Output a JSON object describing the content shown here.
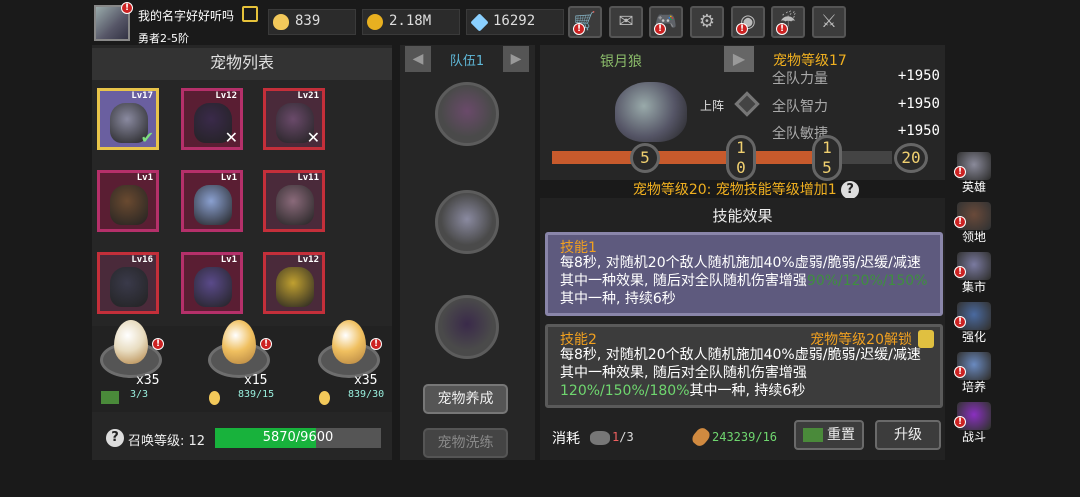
{
  "player": {
    "name": "我的名字好好听吗",
    "rank": "勇者2-5阶"
  },
  "resources": {
    "eggs": "839",
    "gold": "2.18M",
    "gems": "16292"
  },
  "top_buttons": [
    {
      "name": "shop-cart-icon",
      "glyph": "🛒",
      "alert": "!"
    },
    {
      "name": "mail-icon",
      "glyph": "✉",
      "alert": ""
    },
    {
      "name": "gamepad-icon",
      "glyph": "🎮",
      "alert": "!"
    },
    {
      "name": "settings-gear-icon",
      "glyph": "⚙",
      "alert": ""
    },
    {
      "name": "color-wheel-icon",
      "glyph": "◉",
      "alert": "!"
    },
    {
      "name": "rain-icon",
      "glyph": "☔",
      "alert": "!"
    },
    {
      "name": "crossed-swords-icon",
      "glyph": "⚔",
      "alert": ""
    }
  ],
  "pet_list": {
    "title": "宠物列表",
    "pets": [
      {
        "lv": "Lv17",
        "color": "#8a8aa0",
        "mark": "✔"
      },
      {
        "lv": "Lv12",
        "color": "#3a2a4a",
        "mark": "✕"
      },
      {
        "lv": "Lv21",
        "color": "#6a4a6a",
        "mark": "✕"
      },
      {
        "lv": "Lv1",
        "color": "#6a4a30",
        "mark": ""
      },
      {
        "lv": "Lv1",
        "color": "#8aa0d0",
        "mark": ""
      },
      {
        "lv": "Lv11",
        "color": "#8a6a7a",
        "mark": ""
      },
      {
        "lv": "Lv16",
        "color": "#3a3a4a",
        "mark": ""
      },
      {
        "lv": "Lv1",
        "color": "#5a4a8a",
        "mark": ""
      },
      {
        "lv": "Lv12",
        "color": "#c0a030",
        "mark": ""
      }
    ]
  },
  "eggs": [
    {
      "count": "x35",
      "cost_label": "3/3"
    },
    {
      "count": "x15",
      "cost_label": "839/15"
    },
    {
      "count": "x35",
      "cost_label": "839/30"
    }
  ],
  "summon": {
    "label": "召唤等级:",
    "level": "12",
    "progress_text": "5870/9600",
    "progress_fraction": 0.611
  },
  "team": {
    "title": "队伍1"
  },
  "mid_buttons": {
    "raise": "宠物养成",
    "refine": "宠物洗练"
  },
  "pet_detail": {
    "name": "银月狼",
    "level_title": "宠物等级17",
    "deploy_label": "上阵",
    "stats": [
      {
        "name": "全队力量",
        "value": "+1950"
      },
      {
        "name": "全队智力",
        "value": "+1950"
      },
      {
        "name": "全队敏捷",
        "value": "+1950"
      }
    ],
    "milestones": [
      "5",
      "10",
      "15",
      "20"
    ],
    "progress_fraction": 0.85,
    "bonus": "宠物等级20: 宠物技能等级增加1"
  },
  "skills": {
    "title": "技能效果",
    "list": [
      {
        "name": "技能1",
        "desc_a": "每8秒, 对随机20个敌人随机施加40%虚弱/脆弱/迟缓/减速其中一种效果, 随后对全队随机伤害增强",
        "desc_hl": "90%/120%/150%",
        "desc_b": "其中一种, 持续6秒",
        "unlock": ""
      },
      {
        "name": "技能2",
        "desc_a": "每8秒, 对随机20个敌人随机施加40%虚弱/脆弱/迟缓/减速其中一种效果, 随后对全队随机伤害增强",
        "desc_hl": "120%/150%/180%",
        "desc_b": "其中一种, 持续6秒",
        "unlock": "宠物等级20解锁"
      }
    ]
  },
  "cost": {
    "label": "消耗",
    "item_have": "1",
    "item_need": "/3",
    "bones": "243239/16"
  },
  "action_buttons": {
    "reset": "重置",
    "upgrade": "升级"
  },
  "side_nav": [
    {
      "label": "英雄",
      "icon": "helmet-icon",
      "color": "#8a8a9a",
      "alert": "!"
    },
    {
      "label": "领地",
      "icon": "castle-icon",
      "color": "#6a4a3a",
      "alert": "!"
    },
    {
      "label": "集市",
      "icon": "market-icon",
      "color": "#7a7aa0",
      "alert": "!"
    },
    {
      "label": "强化",
      "icon": "crystal-icon",
      "color": "#4a6aa0",
      "alert": "!"
    },
    {
      "label": "培养",
      "icon": "trophy-icon",
      "color": "#6a8ac0",
      "alert": "!"
    },
    {
      "label": "战斗",
      "icon": "portal-icon",
      "color": "#8a30c0",
      "alert": "!"
    }
  ],
  "colors": {
    "accent_orange": "#f0b020",
    "progress_green": "#18b23c",
    "pet_name_green": "#8bbc6a"
  }
}
